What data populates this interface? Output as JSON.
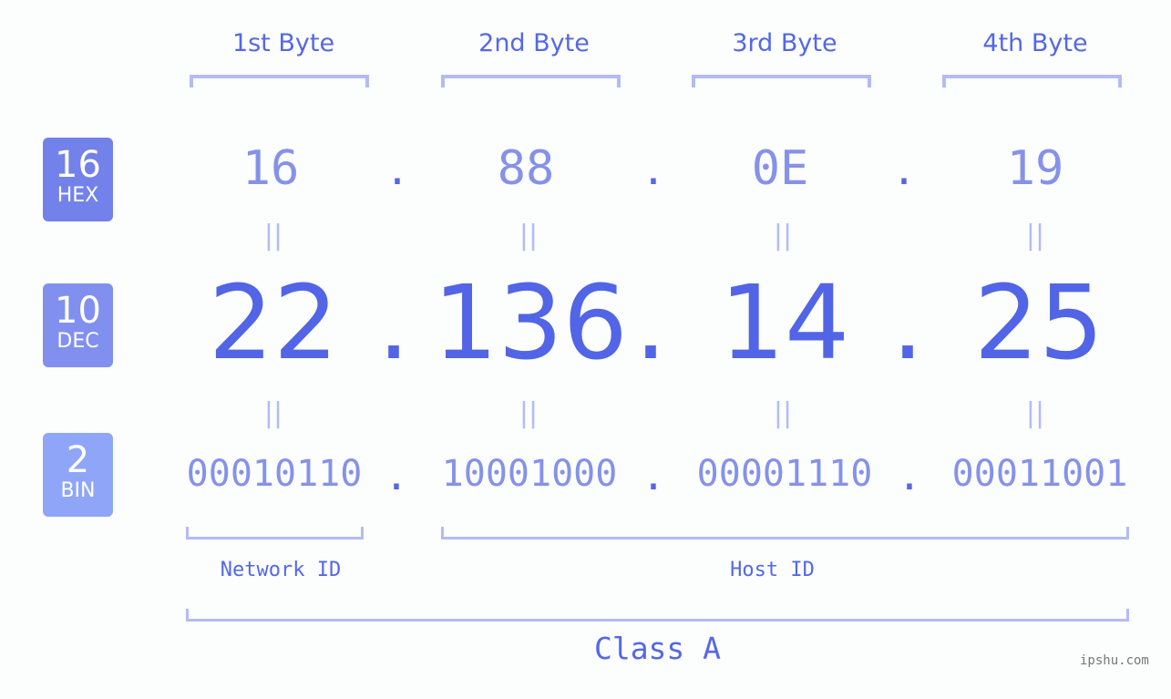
{
  "bytes": [
    {
      "label": "1st Byte",
      "hex": "16",
      "dec": "22",
      "bin": "00010110"
    },
    {
      "label": "2nd Byte",
      "hex": "88",
      "dec": "136",
      "bin": "10001000"
    },
    {
      "label": "3rd Byte",
      "hex": "0E",
      "dec": "14",
      "bin": "00001110"
    },
    {
      "label": "4th Byte",
      "hex": "19",
      "dec": "25",
      "bin": "00011001"
    }
  ],
  "badges": {
    "hex": {
      "num": "16",
      "label": "HEX",
      "color": "#7381ea"
    },
    "dec": {
      "num": "10",
      "label": "DEC",
      "color": "#8190ef"
    },
    "bin": {
      "num": "2",
      "label": "BIN",
      "color": "#8fa6f8"
    }
  },
  "separator": ".",
  "equals": "||",
  "network_label": "Network ID",
  "host_label": "Host ID",
  "class_label": "Class A",
  "watermark": "ipshu.com"
}
